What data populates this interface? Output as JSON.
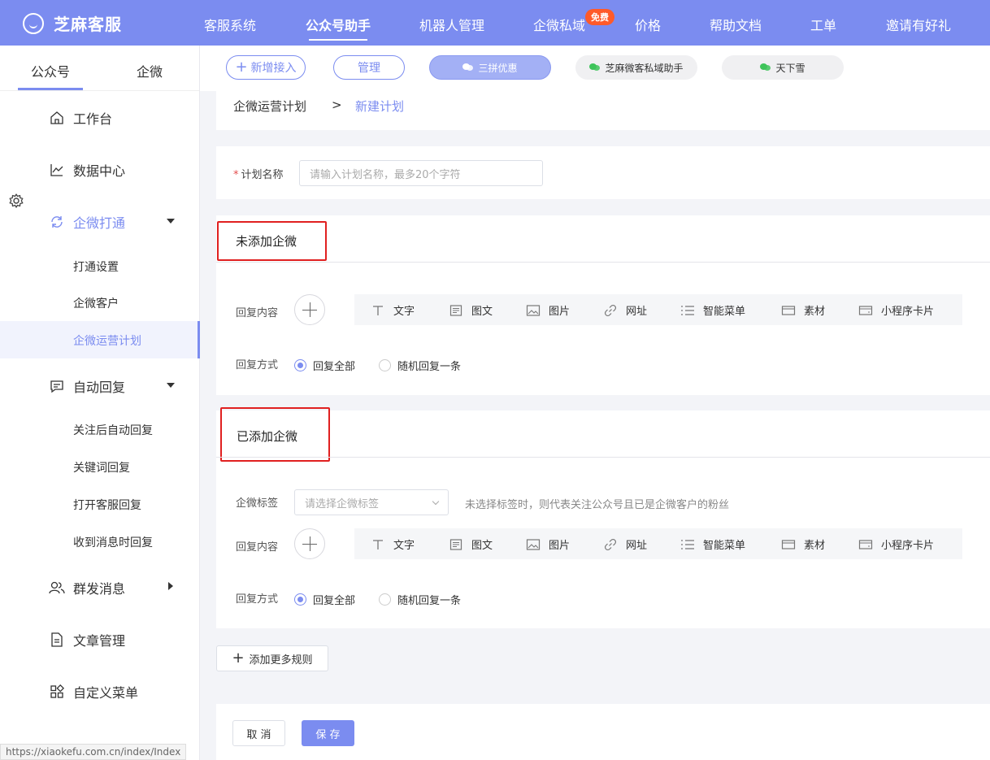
{
  "topbar": {
    "logo_text": "芝麻客服",
    "nav": [
      "客服系统",
      "公众号助手",
      "机器人管理",
      "企微私域",
      "价格",
      "帮助文档",
      "工单",
      "邀请有好礼"
    ],
    "free_badge": "免费",
    "color": "#7b8cf0"
  },
  "sidebar": {
    "tabs": [
      "公众号",
      "企微"
    ],
    "menu": {
      "workbench": "工作台",
      "data_center": "数据中心",
      "wecom_connect": "企微打通",
      "connect_settings": "打通设置",
      "wecom_customers": "企微客户",
      "wecom_plan": "企微运营计划",
      "auto_reply": "自动回复",
      "follow_reply": "关注后自动回复",
      "keyword_reply": "关键词回复",
      "open_cs_reply": "打开客服回复",
      "msg_reply": "收到消息时回复",
      "broadcast": "群发消息",
      "articles": "文章管理",
      "custom_menu": "自定义菜单"
    }
  },
  "actions": {
    "add_access": "新增接入",
    "manage": "管理",
    "accounts": [
      "三拼优惠",
      "芝麻微客私域助手",
      "天下雪"
    ]
  },
  "breadcrumb": {
    "parent": "企微运营计划",
    "separator": ">",
    "current": "新建计划"
  },
  "form": {
    "plan_name_label": "计划名称",
    "plan_name_placeholder": "请输入计划名称，最多20个字符",
    "section_not_added": "未添加企微",
    "section_added": "已添加企微",
    "reply_content_label": "回复内容",
    "reply_mode_label": "回复方式",
    "tag_label": "企微标签",
    "tag_placeholder": "请选择企微标签",
    "tag_hint": "未选择标签时，则代表关注公众号且已是企微客户的粉丝",
    "tools": [
      "文字",
      "图文",
      "图片",
      "网址",
      "智能菜单",
      "素材",
      "小程序卡片"
    ],
    "reply_all": "回复全部",
    "reply_random": "随机回复一条",
    "add_rule": "添加更多规则",
    "cancel": "取 消",
    "save": "保 存"
  },
  "status_url": "https://xiaokefu.com.cn/index/Index"
}
